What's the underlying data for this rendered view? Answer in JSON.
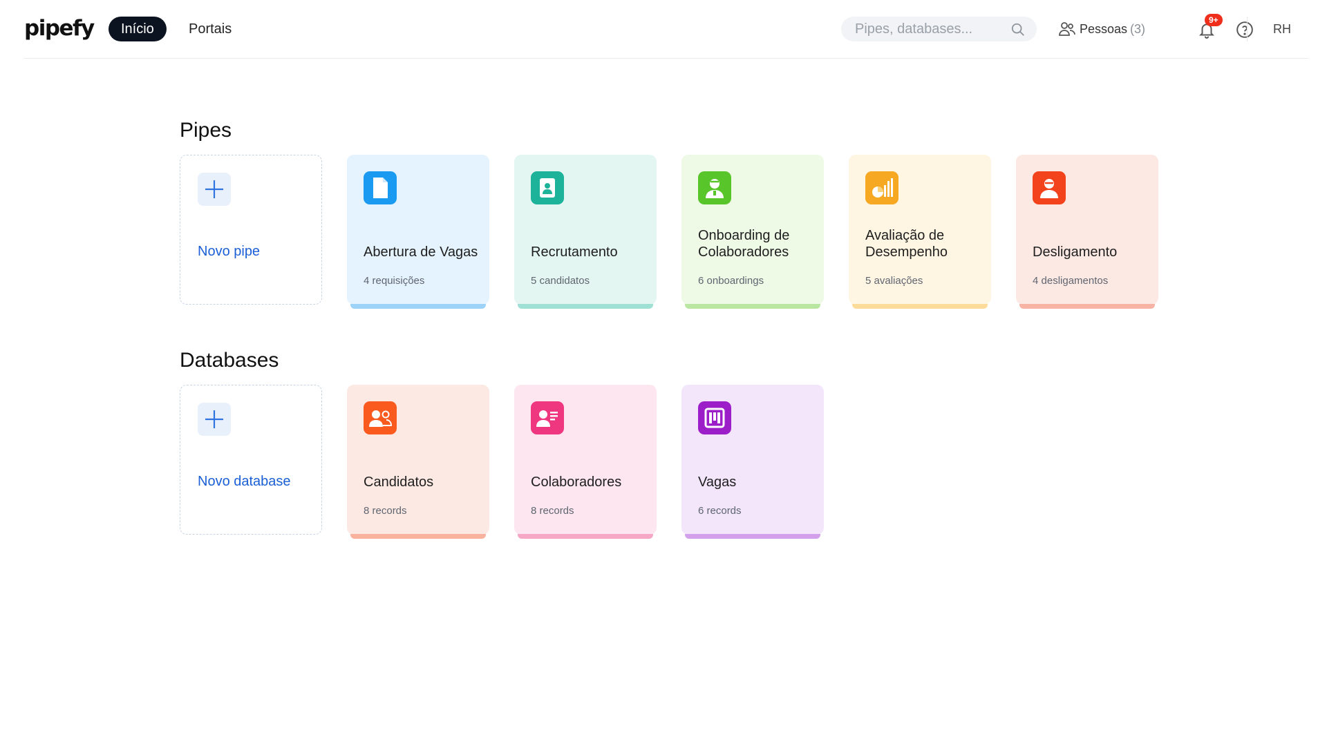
{
  "header": {
    "logo": "pipefy",
    "nav": {
      "active": "Início",
      "portals": "Portais"
    },
    "search": {
      "placeholder": "Pipes, databases..."
    },
    "people": {
      "label": "Pessoas",
      "count": "(3)"
    },
    "notifications": {
      "badge": "9+"
    },
    "user": {
      "initials": "RH"
    }
  },
  "pipes": {
    "title": "Pipes",
    "new_label": "Novo pipe",
    "items": [
      {
        "name": "Abertura de Vagas",
        "sub": "4 requisições",
        "icon": "document-icon",
        "color": "#1a9af0",
        "bg": "#e4f3fd",
        "stripe": "#9dd3f8"
      },
      {
        "name": "Recrutamento",
        "sub": "5 candidatos",
        "icon": "id-badge-icon",
        "color": "#1db39a",
        "bg": "#e4f6f2",
        "stripe": "#9fe0d5"
      },
      {
        "name": "Onboarding de Colaboradores",
        "sub": "6 onboardings",
        "icon": "person-badge-icon",
        "color": "#58c62b",
        "bg": "#eef9e6",
        "stripe": "#b9e7a2"
      },
      {
        "name": "Avaliação de Desempenho",
        "sub": "5 avaliações",
        "icon": "chart-icon",
        "color": "#f7a823",
        "bg": "#fff5e3",
        "stripe": "#fddb9a"
      },
      {
        "name": "Desligamento",
        "sub": "4 desligamentos",
        "icon": "person-exit-icon",
        "color": "#f3431c",
        "bg": "#fde9e4",
        "stripe": "#f7b3a3"
      }
    ]
  },
  "databases": {
    "title": "Databases",
    "new_label": "Novo database",
    "items": [
      {
        "name": "Candidatos",
        "sub": "8 records",
        "icon": "people-icon",
        "color": "#fb5a1e",
        "bg": "#fde9e3",
        "stripe": "#f9b29e"
      },
      {
        "name": "Colaboradores",
        "sub": "8 records",
        "icon": "contact-card-icon",
        "color": "#ef3780",
        "bg": "#fde6ef",
        "stripe": "#f6a7c6"
      },
      {
        "name": "Vagas",
        "sub": "6 records",
        "icon": "kanban-icon",
        "color": "#9b1ec9",
        "bg": "#f3e6fb",
        "stripe": "#d3a0ec"
      }
    ]
  }
}
